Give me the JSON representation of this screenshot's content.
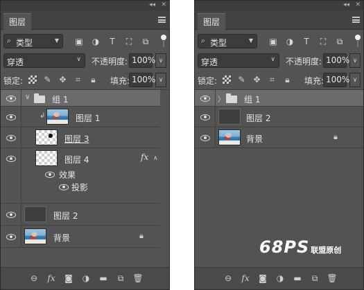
{
  "left_panel": {
    "tab_label": "图层",
    "filter_label": "类型",
    "blend_mode": "穿透",
    "opacity_label": "不透明度:",
    "opacity_value": "100%",
    "lock_label": "锁定:",
    "fill_label": "填充:",
    "fill_value": "100%",
    "layers": {
      "group": "组 1",
      "layer1": "图层 1",
      "layer3": "图层 3",
      "layer4": "图层 4",
      "fx": "fx",
      "effects": "效果",
      "drop_shadow": "投影",
      "layer2": "图层 2",
      "background": "背景"
    }
  },
  "right_panel": {
    "tab_label": "图层",
    "filter_label": "类型",
    "blend_mode": "穿透",
    "opacity_label": "不透明度:",
    "opacity_value": "100%",
    "lock_label": "锁定:",
    "fill_label": "填充:",
    "fill_value": "100%",
    "layers": {
      "group": "组 1",
      "layer2": "图层 2",
      "background": "背景"
    }
  },
  "bottom_toolbar": {
    "fx_label": "fx"
  },
  "watermark": {
    "big": "68PS",
    "small": "联盟原创"
  },
  "icons": [
    "link-icon",
    "fx-icon",
    "mask-icon",
    "adjustment-icon",
    "folder-icon",
    "new-layer-icon",
    "trash-icon",
    "search-icon",
    "image-filter-icon",
    "adjustment-filter-icon",
    "text-filter-icon",
    "shape-filter-icon",
    "smart-object-filter-icon",
    "eye-icon",
    "lock-icon",
    "move-icon",
    "artboard-icon",
    "checker-icon"
  ]
}
